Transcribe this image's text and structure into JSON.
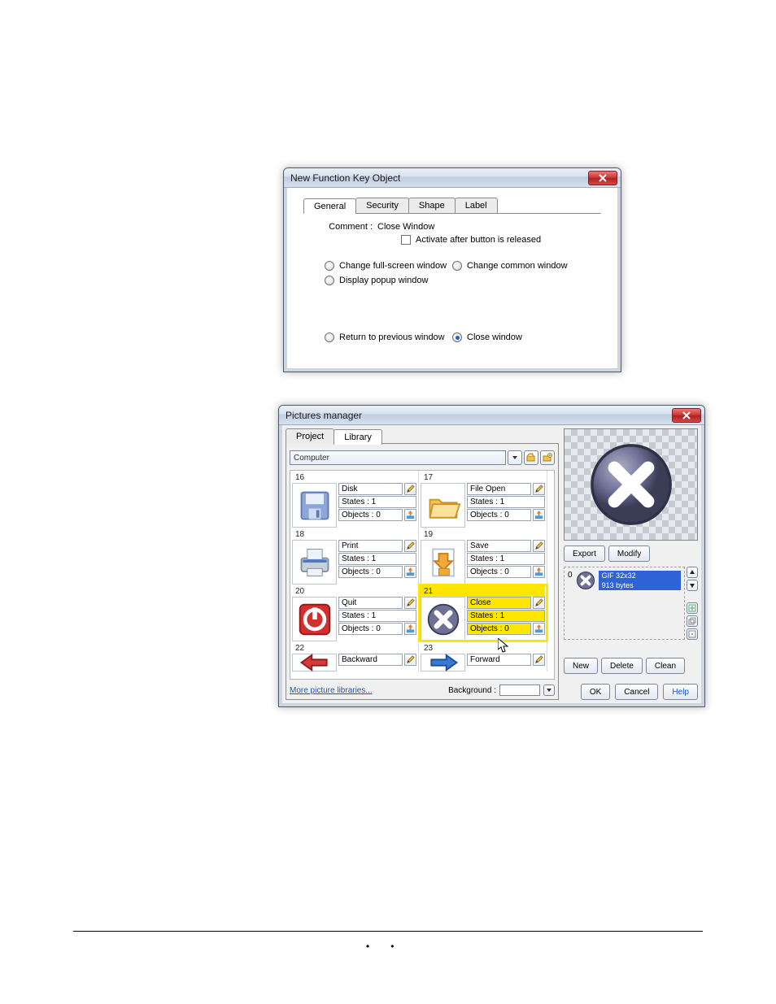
{
  "dialog1": {
    "title": "New  Function Key Object",
    "tabs": {
      "general": "General",
      "security": "Security",
      "shape": "Shape",
      "label": "Label"
    },
    "comment_label": "Comment :",
    "comment_value": "Close Window",
    "activate_label": "Activate after button is released",
    "opt_fullscreen": "Change full-screen window",
    "opt_popup": "Display popup window",
    "opt_common": "Change common window",
    "opt_return": "Return to previous window",
    "opt_close": "Close window"
  },
  "dialog2": {
    "title": "Pictures manager",
    "tabs": {
      "project": "Project",
      "library": "Library"
    },
    "path": "Computer",
    "more_link": "More picture libraries...",
    "bg_label": "Background :",
    "buttons": {
      "export": "Export",
      "modify": "Modify",
      "new": "New",
      "delete": "Delete",
      "clean": "Clean",
      "ok": "OK",
      "cancel": "Cancel",
      "help": "Help"
    },
    "state_info_line1": "GIF 32x32",
    "state_info_line2": "913 bytes",
    "state_index": "0",
    "items": [
      {
        "num": "16",
        "name": "Disk",
        "states": "States : 1",
        "objects": "Objects : 0",
        "icon": "disk"
      },
      {
        "num": "17",
        "name": "File Open",
        "states": "States : 1",
        "objects": "Objects : 0",
        "icon": "folder"
      },
      {
        "num": "18",
        "name": "Print",
        "states": "States : 1",
        "objects": "Objects : 0",
        "icon": "printer"
      },
      {
        "num": "19",
        "name": "Save",
        "states": "States : 1",
        "objects": "Objects : 0",
        "icon": "save"
      },
      {
        "num": "20",
        "name": "Quit",
        "states": "States : 1",
        "objects": "Objects : 0",
        "icon": "quit"
      },
      {
        "num": "21",
        "name": "Close",
        "states": "States : 1",
        "objects": "Objects : 0",
        "icon": "close",
        "hi": true
      },
      {
        "num": "22",
        "name": "Backward",
        "states": "",
        "objects": "",
        "icon": "back"
      },
      {
        "num": "23",
        "name": "Forward",
        "states": "",
        "objects": "",
        "icon": "fwd"
      }
    ]
  }
}
